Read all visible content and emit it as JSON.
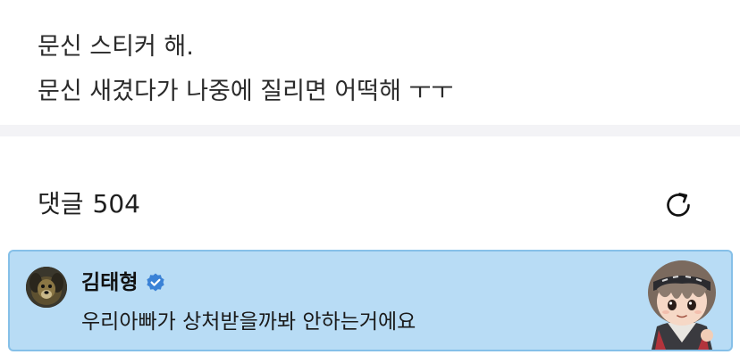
{
  "post": {
    "lines": [
      "문신 스티커 해.",
      "문신 새겼다가 나중에 질리면 어떡해 ㅜㅜ"
    ]
  },
  "comments_header": {
    "label": "댓글",
    "count": "504",
    "refresh_icon": "refresh-icon"
  },
  "comment": {
    "author": "김태형",
    "verified_icon": "verified-badge-icon",
    "text": "우리아빠가 상처받을까봐 안하는거에요",
    "highlight_color": "#b8dcf5",
    "avatar_icon": "dog-avatar-icon",
    "sticker_icon": "character-sticker-icon"
  }
}
